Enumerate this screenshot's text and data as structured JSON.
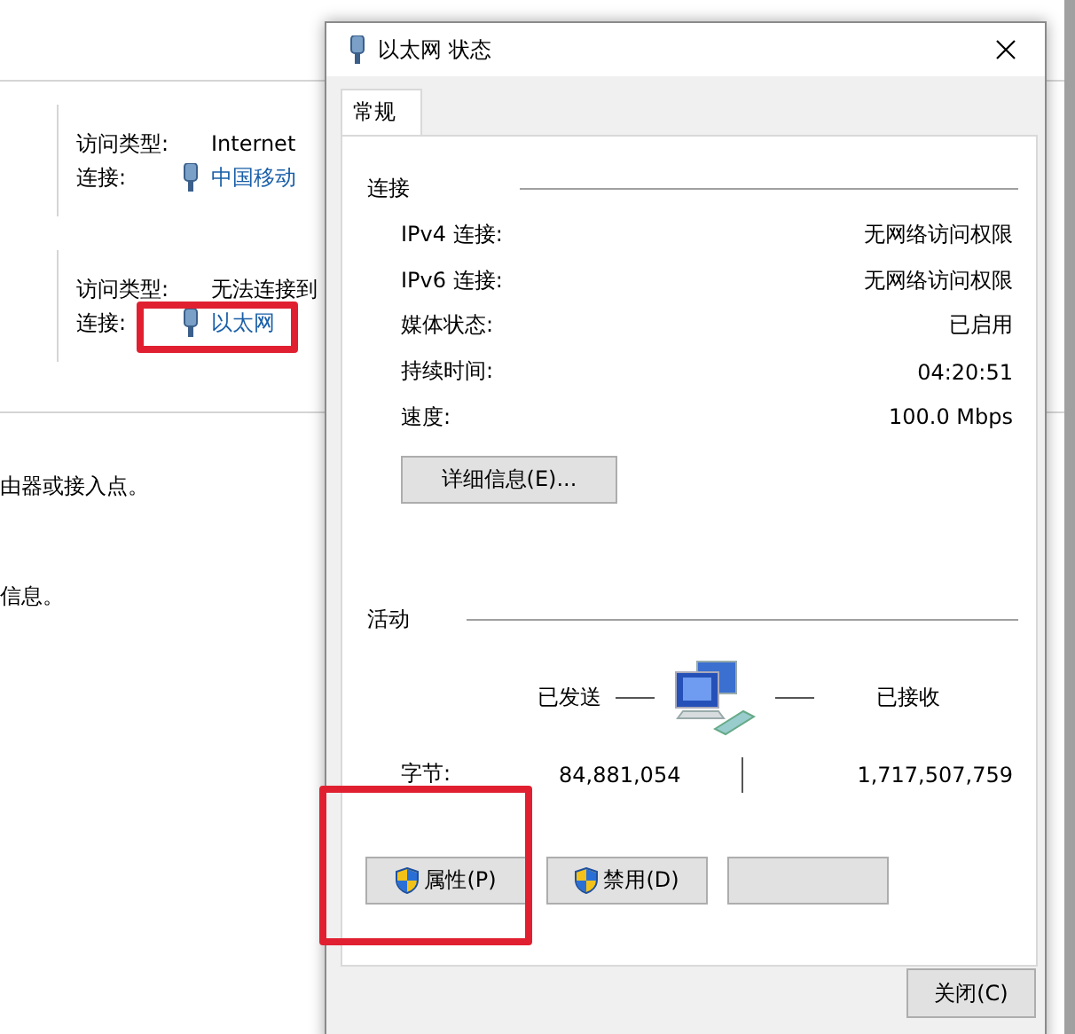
{
  "background_window": {
    "networks": [
      {
        "access_type_label": "访问类型:",
        "access_type": "Internet",
        "connection_label": "连接:",
        "connection": "中国移动"
      },
      {
        "access_type_label": "访问类型:",
        "access_type": "无法连接到",
        "connection_label": "连接:",
        "connection": "以太网"
      }
    ],
    "lines": [
      "由器或接入点。",
      "信息。"
    ]
  },
  "dialog": {
    "title": "以太网 状态",
    "tabs": [
      {
        "label": "常规",
        "selected": true
      }
    ],
    "connection": {
      "heading": "连接",
      "rows": [
        {
          "label": "IPv4 连接:",
          "value": "无网络访问权限"
        },
        {
          "label": "IPv6 连接:",
          "value": "无网络访问权限"
        },
        {
          "label": "媒体状态:",
          "value": "已启用"
        },
        {
          "label": "持续时间:",
          "value": "04:20:51"
        },
        {
          "label": "速度:",
          "value": "100.0 Mbps"
        }
      ],
      "details_button": "详细信息(E)..."
    },
    "activity": {
      "heading": "活动",
      "sent_label": "已发送",
      "received_label": "已接收",
      "bytes_label": "字节:",
      "bytes_sent": "84,881,054",
      "bytes_received": "1,717,507,759"
    },
    "buttons": [
      {
        "kind": "shield",
        "label": "属性(P)"
      },
      {
        "kind": "shield",
        "label": "禁用(D)"
      },
      {
        "kind": "blank"
      }
    ],
    "close_button": "关闭(C)"
  }
}
